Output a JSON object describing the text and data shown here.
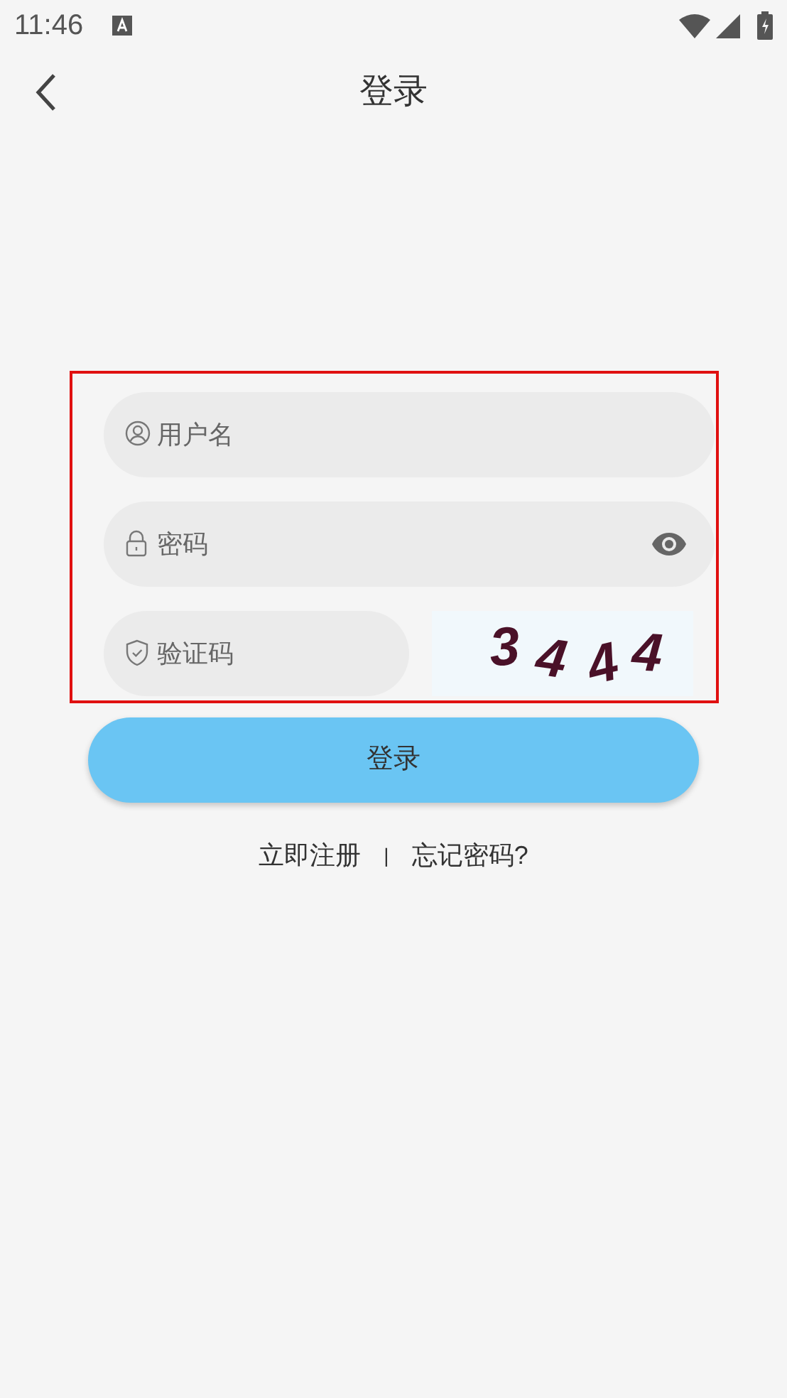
{
  "status_bar": {
    "time": "11:46"
  },
  "header": {
    "title": "登录"
  },
  "form": {
    "highlighted": true,
    "fields": [
      {
        "kind": "user",
        "placeholder": "用户名"
      },
      {
        "kind": "password",
        "placeholder": "密码"
      },
      {
        "kind": "captcha",
        "placeholder": "验证码"
      }
    ],
    "captcha": "3444"
  },
  "login_button": "登录",
  "links": {
    "register": "立即注册",
    "separator": "|",
    "forgot": "忘记密码?"
  }
}
